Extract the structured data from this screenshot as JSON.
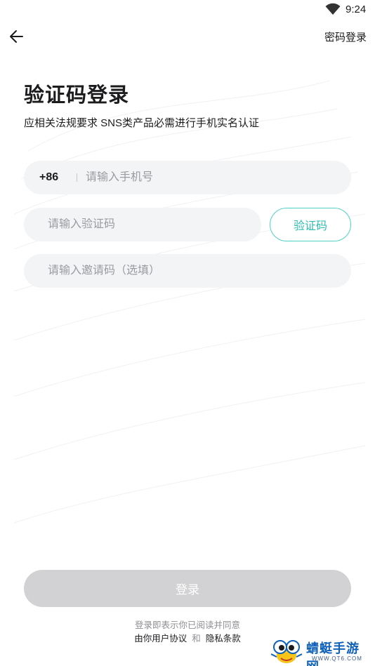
{
  "status_bar": {
    "time": "9:24",
    "wifi_icon": "wifi-icon"
  },
  "header": {
    "back_icon": "arrow-left-icon",
    "password_login": "密码登录"
  },
  "page": {
    "title": "验证码登录",
    "subtitle": "应相关法规要求 SNS类产品必需进行手机实名认证"
  },
  "form": {
    "country_code": "+86",
    "phone_placeholder": "请输入手机号",
    "code_placeholder": "请输入验证码",
    "get_code_label": "验证码",
    "invite_placeholder": "请输入邀请码（选填）"
  },
  "login_button": "登录",
  "agreement": {
    "prefix": "登录即表示你已阅读并同意",
    "user_agreement": "由你用户协议",
    "and": "和",
    "privacy_policy": "隐私条款"
  },
  "watermark": {
    "brand": "蜻蜓手游网",
    "url": "WWW.QT6.COM"
  },
  "colors": {
    "accent": "#4fd1c5",
    "disabled_button": "#d2d2d4",
    "field_bg": "#f3f4f6"
  }
}
